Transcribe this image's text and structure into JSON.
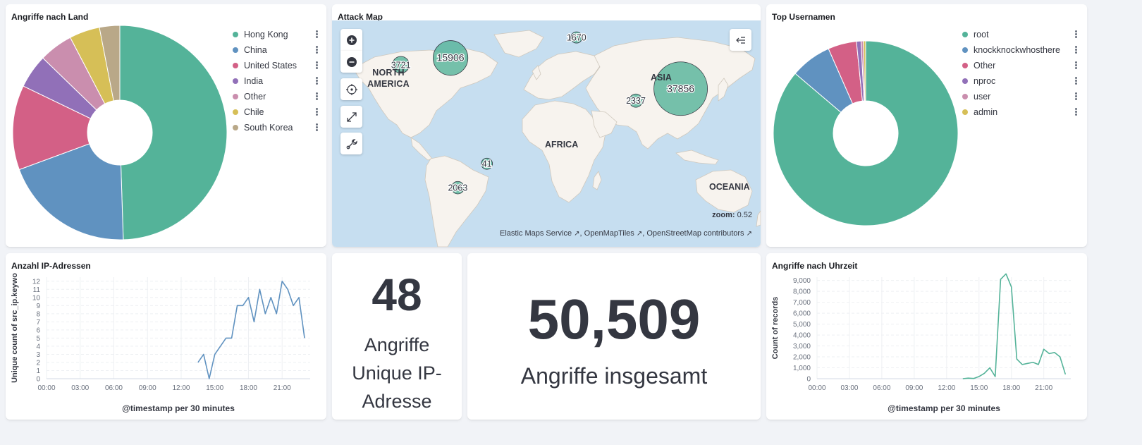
{
  "panels": {
    "countries": {
      "title": "Angriffe nach Land"
    },
    "map": {
      "title": "Attack Map"
    },
    "usernames": {
      "title": "Top Usernamen"
    },
    "ips": {
      "title": "Anzahl IP-Adressen"
    },
    "unique_ip": {
      "title": ""
    },
    "total": {
      "title": ""
    },
    "by_time": {
      "title": "Angriffe nach Uhrzeit"
    }
  },
  "colors": {
    "teal": "#54b399",
    "blue": "#6092c0",
    "pink": "#d36086",
    "purple": "#9170b8",
    "lightpink": "#ca8eae",
    "yellow": "#d6bf57",
    "tan": "#b9a888"
  },
  "chart_data": [
    {
      "type": "pie",
      "title": "Angriffe nach Land",
      "donut": true,
      "legend_position": "top-right",
      "categories": [
        "Hong Kong",
        "China",
        "United States",
        "India",
        "Other",
        "Chile",
        "South Korea"
      ],
      "values": [
        48.5,
        19.5,
        12.5,
        5.0,
        5.0,
        4.5,
        3.0
      ],
      "colors": [
        "#54b399",
        "#6092c0",
        "#d36086",
        "#9170b8",
        "#ca8eae",
        "#d6bf57",
        "#b9a888"
      ]
    },
    {
      "type": "pie",
      "title": "Top Usernamen",
      "donut": true,
      "legend_position": "top-right",
      "categories": [
        "root",
        "knockknockwhosthere",
        "Other",
        "nproc",
        "user",
        "admin"
      ],
      "values": [
        86.2,
        7.2,
        5.0,
        0.8,
        0.4,
        0.4
      ],
      "colors": [
        "#54b399",
        "#6092c0",
        "#d36086",
        "#9170b8",
        "#ca8eae",
        "#d6bf57"
      ]
    },
    {
      "type": "line",
      "title": "Anzahl IP-Adressen",
      "xlabel": "@timestamp per 30 minutes",
      "ylabel": "Unique count of src_ip.keywo",
      "x_ticks": [
        "00:00",
        "03:00",
        "06:00",
        "09:00",
        "12:00",
        "15:00",
        "18:00",
        "21:00"
      ],
      "y_ticks": [
        "0",
        "1",
        "2",
        "3",
        "4",
        "5",
        "6",
        "7",
        "8",
        "9",
        "10",
        "11",
        "12"
      ],
      "ylim": [
        0,
        12.5
      ],
      "xlim_hours": [
        0,
        23.5
      ],
      "grid": true,
      "color": "#6092c0",
      "x_hours": [
        13.5,
        14.0,
        14.5,
        15.0,
        15.5,
        16.0,
        16.5,
        17.0,
        17.5,
        18.0,
        18.5,
        19.0,
        19.5,
        20.0,
        20.5,
        21.0,
        21.5,
        22.0,
        22.5,
        23.0
      ],
      "values": [
        2,
        3,
        0,
        3,
        4,
        5,
        5,
        9,
        9,
        10,
        7,
        11,
        8,
        10,
        8,
        12,
        11,
        9,
        10,
        5
      ]
    },
    {
      "type": "line",
      "title": "Angriffe nach Uhrzeit",
      "xlabel": "@timestamp per 30 minutes",
      "ylabel": "Count of records",
      "x_ticks": [
        "00:00",
        "03:00",
        "06:00",
        "09:00",
        "12:00",
        "15:00",
        "18:00",
        "21:00"
      ],
      "y_ticks": [
        "0",
        "1,000",
        "2,000",
        "3,000",
        "4,000",
        "5,000",
        "6,000",
        "7,000",
        "8,000",
        "9,000"
      ],
      "ylim": [
        0,
        9300
      ],
      "xlim_hours": [
        0,
        23.5
      ],
      "grid": true,
      "color": "#54b399",
      "x_hours": [
        13.5,
        14.0,
        14.5,
        15.0,
        15.5,
        16.0,
        16.5,
        17.0,
        17.5,
        18.0,
        18.5,
        19.0,
        19.5,
        20.0,
        20.5,
        21.0,
        21.5,
        22.0,
        22.5,
        23.0
      ],
      "values": [
        0,
        50,
        20,
        200,
        500,
        1000,
        200,
        9100,
        9600,
        8400,
        1800,
        1300,
        1400,
        1500,
        1300,
        2700,
        2300,
        2400,
        2000,
        400
      ]
    }
  ],
  "map": {
    "region_labels": [
      "NORTH AMERICA",
      "ASIA",
      "AFRICA",
      "OCEANIA"
    ],
    "clusters": [
      {
        "label": "1670",
        "lon": 28,
        "lat": 52
      },
      {
        "label": "3721",
        "lon": -117,
        "lat": 36
      },
      {
        "label": "15906",
        "lon": -76,
        "lat": 40
      },
      {
        "label": "37856",
        "lon": 114,
        "lat": 22
      },
      {
        "label": "2337",
        "lon": 77,
        "lat": 15
      },
      {
        "label": "41",
        "lon": -46,
        "lat": -22
      },
      {
        "label": "2063",
        "lon": -70,
        "lat": -36
      }
    ],
    "zoom_label": "zoom:",
    "zoom_value": "0.52",
    "attribution": [
      "Elastic Maps Service",
      "OpenMapTiles",
      "OpenStreetMap contributors"
    ],
    "tools": [
      "zoom-in",
      "zoom-out",
      "locate",
      "fit-bounds",
      "tools"
    ]
  },
  "metrics": {
    "unique_ip": {
      "value": "48",
      "label_lines": [
        "Angriffe",
        "Unique IP-",
        "Adresse"
      ]
    },
    "total": {
      "value": "50,509",
      "label": "Angriffe insgesamt"
    }
  }
}
